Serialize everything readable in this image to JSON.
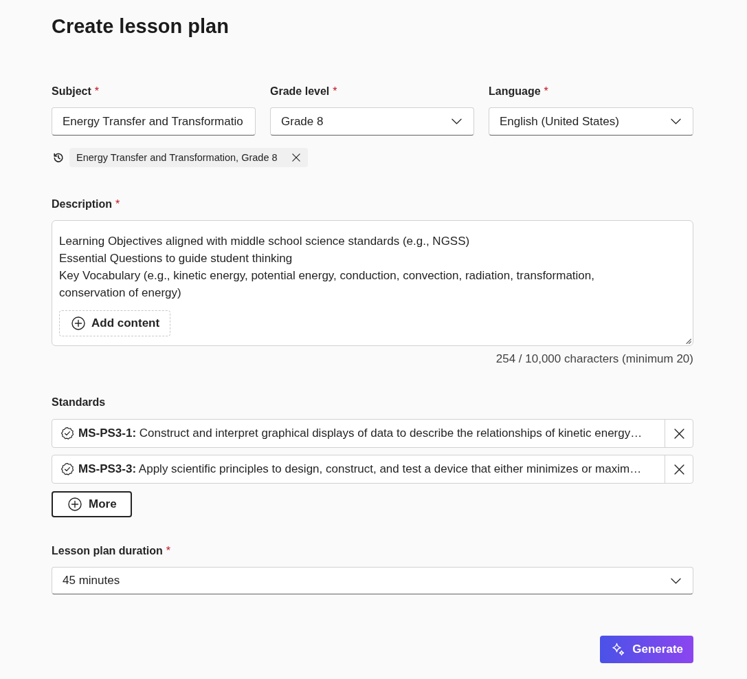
{
  "page": {
    "title": "Create lesson plan"
  },
  "fields": [
    {
      "kind": "text",
      "label": "Subject",
      "required_mark": "*",
      "value": "Energy Transfer and Transformatio"
    },
    {
      "kind": "dropdown",
      "label": "Grade level",
      "required_mark": "*",
      "value": "Grade 8"
    },
    {
      "kind": "dropdown",
      "label": "Language",
      "required_mark": "*",
      "value": "English (United States)"
    }
  ],
  "recent_subjects": [
    {
      "label": "Energy Transfer and Transformation, Grade 8"
    }
  ],
  "description": {
    "label": "Description",
    "required_mark": "*",
    "value": "Learning Objectives aligned with middle school science standards (e.g., NGSS)\nEssential Questions to guide student thinking\nKey Vocabulary (e.g., kinetic energy, potential energy, conduction, convection, radiation, transformation, conservation of energy)",
    "add_button": "Add content",
    "counter": "254 / 10,000 characters (minimum 20)"
  },
  "standards": {
    "label": "Standards",
    "items": [
      {
        "text": "**MS-PS3-1:** Construct and interpret graphical displays of data to describe the relationships of kinetic energy…"
      },
      {
        "text": "**MS-PS3-3:** Apply scientific principles to design, construct, and test a device that either minimizes or maxim…"
      }
    ],
    "more_button": "More"
  },
  "duration": {
    "kind": "dropdown",
    "label": "Lesson plan duration",
    "required_mark": "*",
    "value": "45 minutes"
  },
  "generate_button": "Generate"
}
